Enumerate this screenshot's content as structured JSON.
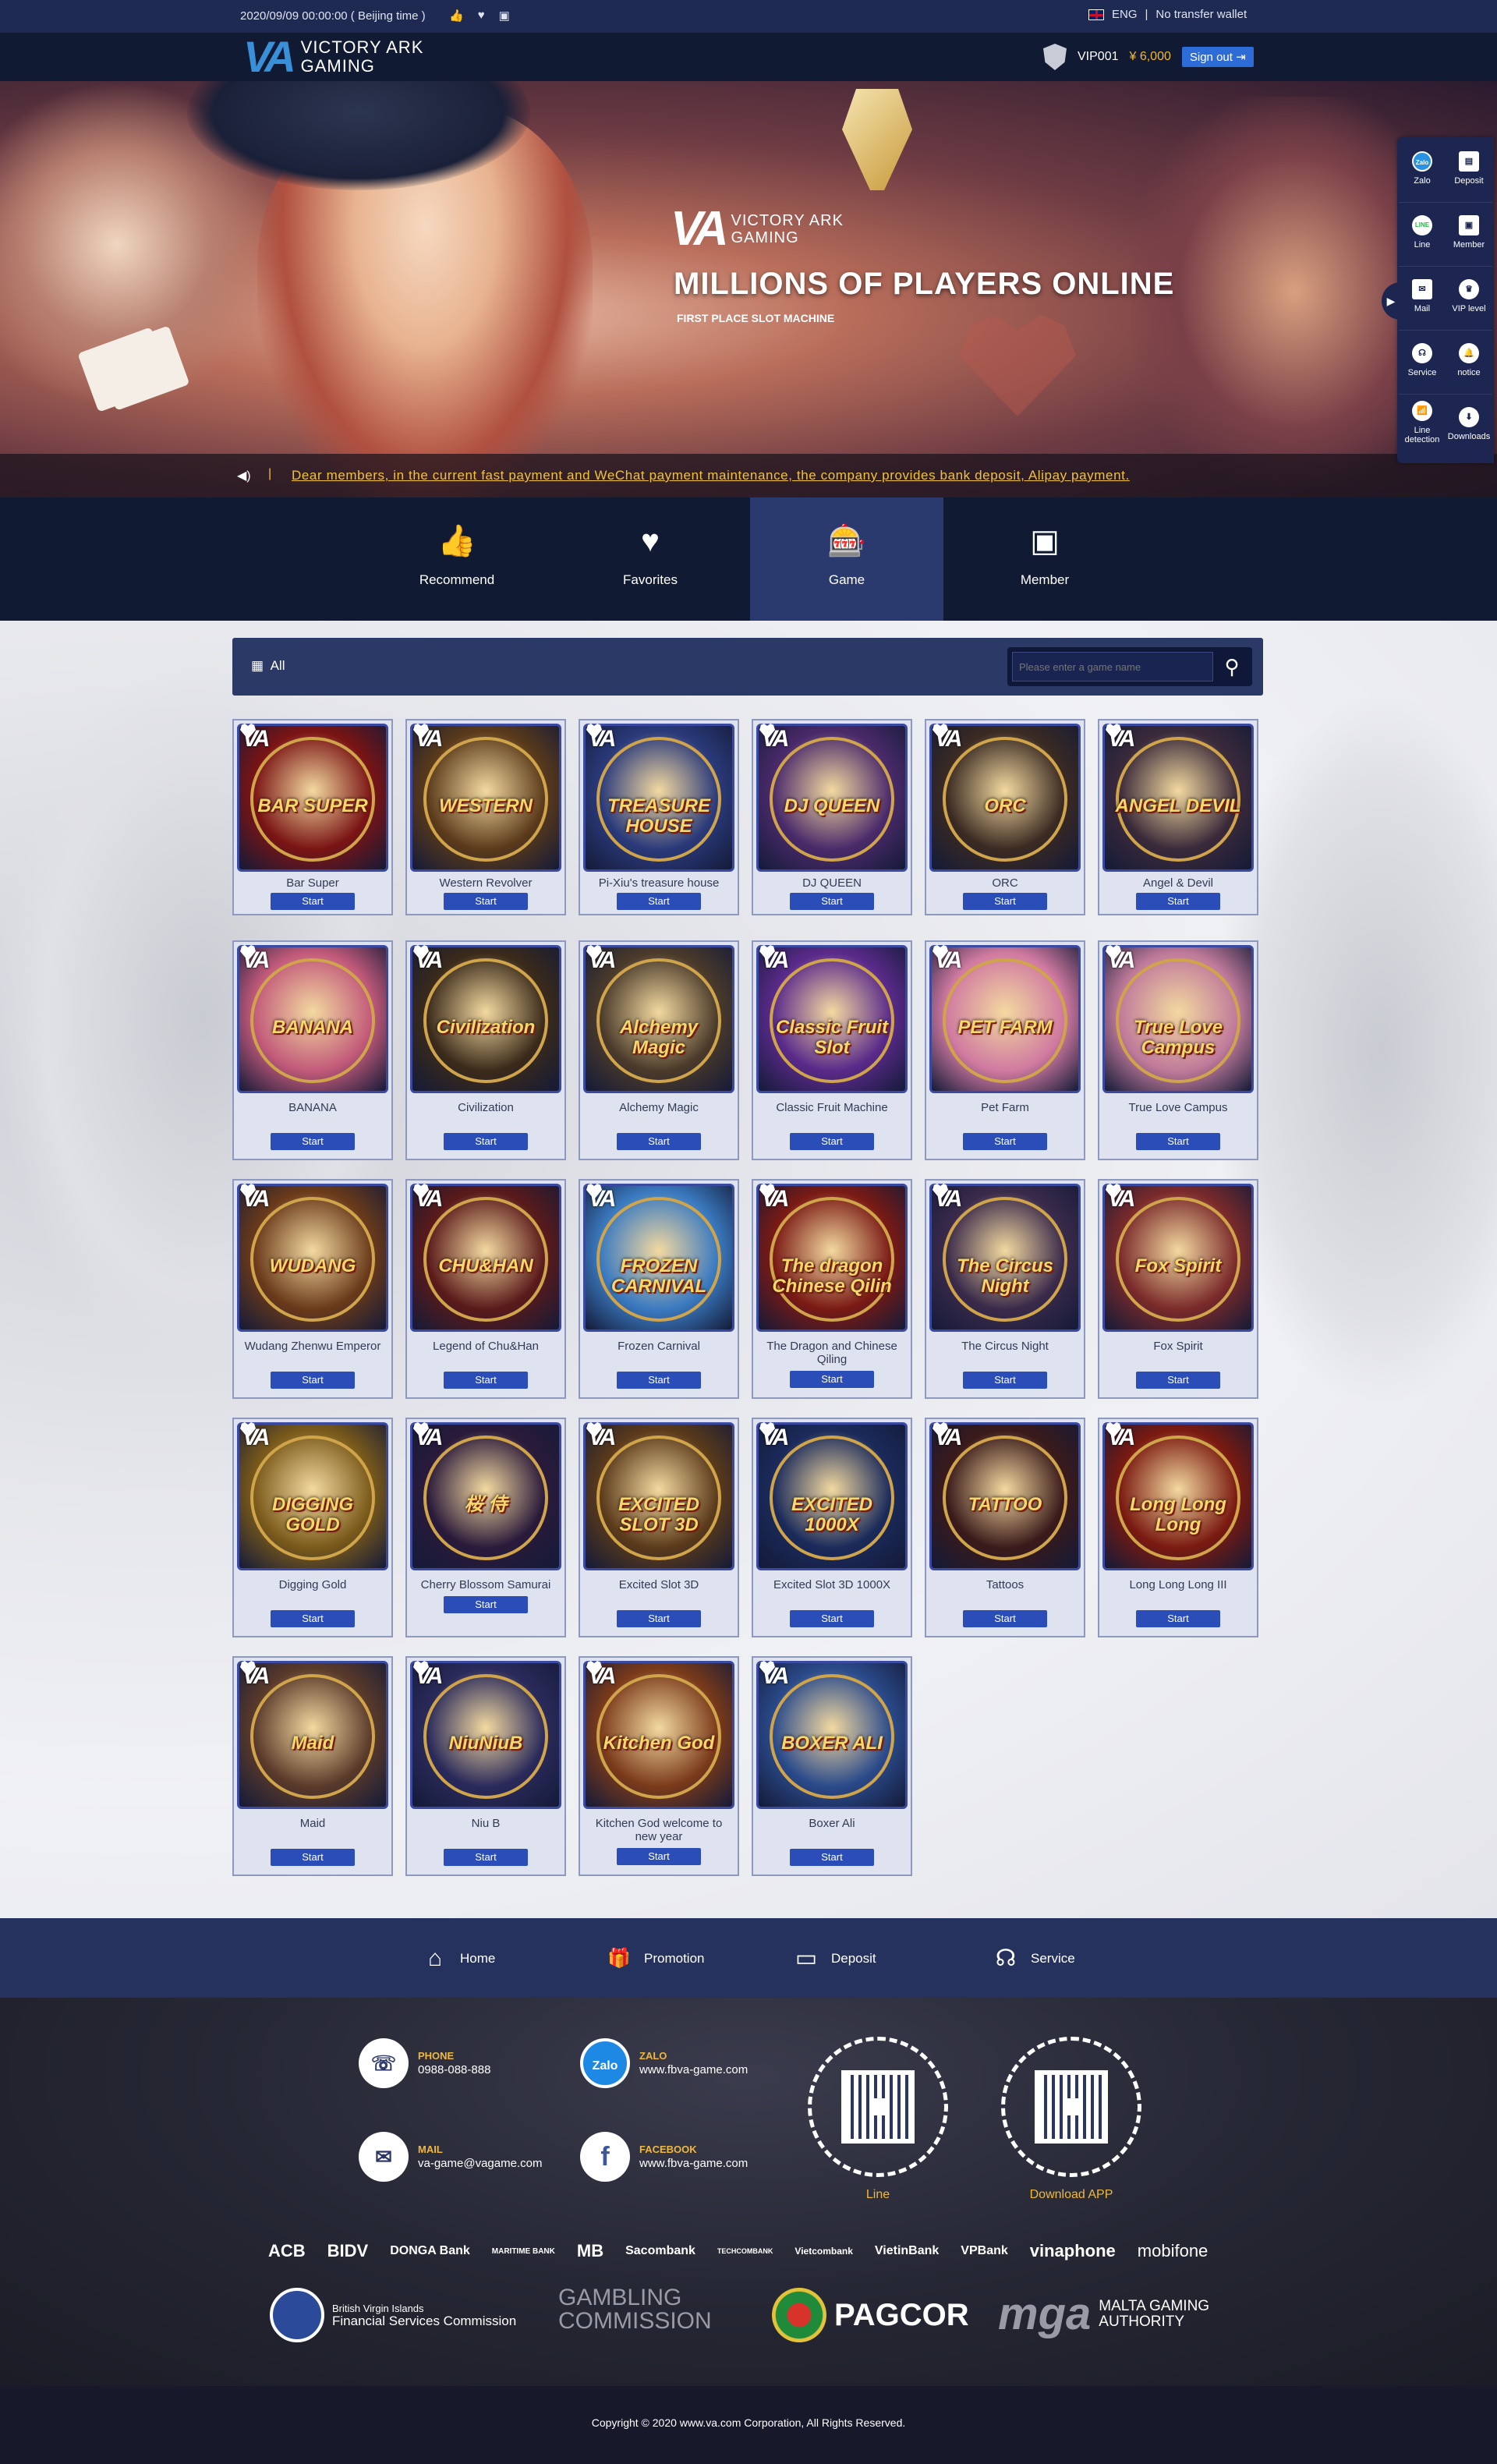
{
  "topbar": {
    "time": "2020/09/09  00:00:00 ( Beijing time )",
    "language": "ENG",
    "wallet": "No transfer wallet"
  },
  "header": {
    "logo_mark": "VA",
    "logo_line1": "VICTORY ARK",
    "logo_line2": "GAMING",
    "vip": "VIP001",
    "balance": "¥ 6,000",
    "signout": "Sign out"
  },
  "banner": {
    "logo_mark": "VA",
    "logo_line1": "VICTORY ARK",
    "logo_line2": "GAMING",
    "title": "MILLIONS OF PLAYERS ONLINE",
    "subtitle": "FIRST PLACE SLOT MACHINE",
    "notice": "Dear members, in the current fast payment and WeChat payment maintenance, the company provides bank deposit, Alipay payment."
  },
  "sidebar": {
    "items": [
      {
        "label": "Zalo",
        "icon": "Zalo"
      },
      {
        "label": "Deposit",
        "icon": "▤"
      },
      {
        "label": "Line",
        "icon": "LINE"
      },
      {
        "label": "Member",
        "icon": "▣"
      },
      {
        "label": "Mail",
        "icon": "✉"
      },
      {
        "label": "VIP level",
        "icon": "♛"
      },
      {
        "label": "Service",
        "icon": "☊"
      },
      {
        "label": "notice",
        "icon": "🔔"
      },
      {
        "label": "Line detection",
        "icon": "📶"
      },
      {
        "label": "Downloads",
        "icon": "⬇"
      }
    ]
  },
  "nav": {
    "items": [
      {
        "label": "Recommend",
        "icon": "👍"
      },
      {
        "label": "Favorites",
        "icon": "♥"
      },
      {
        "label": "Game",
        "icon": "🎰"
      },
      {
        "label": "Member",
        "icon": "▣"
      }
    ]
  },
  "filter": {
    "all": "All",
    "search_placeholder": "Please enter a game name"
  },
  "games": [
    {
      "name": "Bar Super",
      "art": "BAR SUPER",
      "color": "#7a1414",
      "start": "Start"
    },
    {
      "name": "Western Revolver",
      "art": "WESTERN",
      "color": "#5a3a1a",
      "start": "Start"
    },
    {
      "name": "Pi-Xiu's treasure house",
      "art": "TREASURE HOUSE",
      "color": "#2a3a7a",
      "start": "Start"
    },
    {
      "name": "DJ QUEEN",
      "art": "DJ QUEEN",
      "color": "#4a2a6a",
      "start": "Start"
    },
    {
      "name": "ORC",
      "art": "ORC",
      "color": "#3a2a22",
      "start": "Start"
    },
    {
      "name": "Angel & Devil",
      "art": "ANGEL DEVIL",
      "color": "#3a2a3a",
      "start": "Start"
    },
    {
      "name": "BANANA",
      "art": "BANANA",
      "color": "#c25a7a",
      "start": "Start"
    },
    {
      "name": "Civilization",
      "art": "Civilization",
      "color": "#3a2a1a",
      "start": "Start"
    },
    {
      "name": "Alchemy Magic",
      "art": "Alchemy Magic",
      "color": "#4a3a2a",
      "start": "Start"
    },
    {
      "name": "Classic Fruit Machine",
      "art": "Classic Fruit Slot",
      "color": "#5a2a8a",
      "start": "Start"
    },
    {
      "name": "Pet Farm",
      "art": "PET FARM",
      "color": "#d07aa0",
      "start": "Start"
    },
    {
      "name": "True Love Campus",
      "art": "True Love Campus",
      "color": "#c07a9a",
      "start": "Start"
    },
    {
      "name": "Wudang Zhenwu Emperor",
      "art": "WUDANG",
      "color": "#6a3a1a",
      "start": "Start"
    },
    {
      "name": "Legend of Chu&Han",
      "art": "CHU&HAN",
      "color": "#5a1a1a",
      "start": "Start"
    },
    {
      "name": "Frozen Carnival",
      "art": "FROZEN CARNIVAL",
      "color": "#3a7ac0",
      "start": "Start"
    },
    {
      "name": "The Dragon and Chinese Qiling",
      "art": "The dragon Chinese Qilin",
      "color": "#7a1a14",
      "start": "Start"
    },
    {
      "name": "The Circus Night",
      "art": "The Circus Night",
      "color": "#3a2a4a",
      "start": "Start"
    },
    {
      "name": "Fox Spirit",
      "art": "Fox Spirit",
      "color": "#7a2a2a",
      "start": "Start"
    },
    {
      "name": "Digging Gold",
      "art": "DIGGING GOLD",
      "color": "#7a5a1a",
      "start": "Start"
    },
    {
      "name": "Cherry Blossom Samurai",
      "art": "桜 侍",
      "color": "#2a1a3a",
      "start": "Start"
    },
    {
      "name": "Excited Slot 3D",
      "art": "EXCITED SLOT 3D",
      "color": "#5a3a1a",
      "start": "Start"
    },
    {
      "name": "Excited Slot 3D 1000X",
      "art": "EXCITED 1000X",
      "color": "#1a2a5a",
      "start": "Start"
    },
    {
      "name": "Tattoos",
      "art": "TATTOO",
      "color": "#3a1a1a",
      "start": "Start"
    },
    {
      "name": "Long Long Long III",
      "art": "Long Long Long",
      "color": "#7a1a10",
      "start": "Start"
    },
    {
      "name": "Maid",
      "art": "Maid",
      "color": "#5a3a2a",
      "start": "Start"
    },
    {
      "name": "Niu B",
      "art": "NiuNiuB",
      "color": "#2a2a5a",
      "start": "Start"
    },
    {
      "name": "Kitchen God welcome to new year",
      "art": "Kitchen God",
      "color": "#7a3a1a",
      "start": "Start"
    },
    {
      "name": "Boxer Ali",
      "art": "BOXER ALI",
      "color": "#2a4a8a",
      "start": "Start"
    }
  ],
  "bottom_nav": [
    {
      "label": "Home",
      "icon": "⌂"
    },
    {
      "label": "Promotion",
      "icon": "🎁"
    },
    {
      "label": "Deposit",
      "icon": "▭"
    },
    {
      "label": "Service",
      "icon": "☊"
    }
  ],
  "footer": {
    "phone_label": "PHONE",
    "phone": "0988-088-888",
    "zalo_label": "ZALO",
    "zalo": "www.fbva-game.com",
    "mail_label": "MAIL",
    "mail": "va-game@vagame.com",
    "facebook_label": "FACEBOOK",
    "facebook": "www.fbva-game.com",
    "qr_line": "Line",
    "qr_app": "Download APP",
    "banks": [
      "ACB",
      "BIDV",
      "DONGA Bank",
      "MARITIME BANK",
      "MB",
      "Sacombank",
      "TECHCOMBANK",
      "Vietcombank",
      "VietinBank",
      "VPBank",
      "vinaphone",
      "mobifone"
    ],
    "lic_bvi_1": "British Virgin Islands",
    "lic_bvi_2": "Financial Services Commission",
    "lic_gc_1": "GAMBLING",
    "lic_gc_2": "COMMISSION",
    "lic_pagcor": "PAGCOR",
    "lic_mga": "mga",
    "lic_mga_1": "MALTA GAMING",
    "lic_mga_2": "AUTHORITY"
  },
  "copyright": "Copyright © 2020 www.va.com Corporation, All Rights Reserved."
}
